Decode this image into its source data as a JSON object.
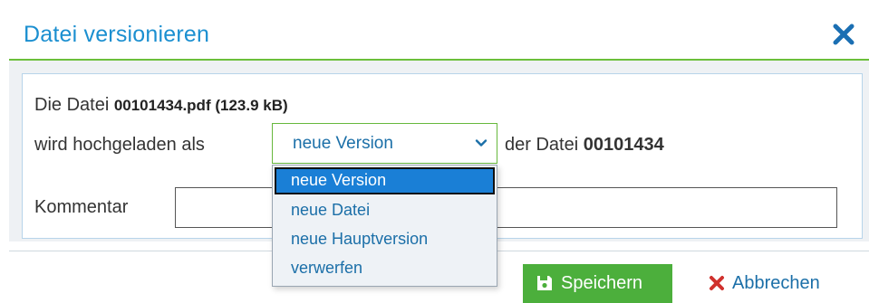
{
  "dialog": {
    "title": "Datei versionieren",
    "close_icon": "close-icon",
    "accent_color": "#1b8fd0",
    "rule_color": "#6bbf3a"
  },
  "body": {
    "line1_prefix": "Die Datei ",
    "file_info": "00101434.pdf (123.9 kB)",
    "line2_prefix": "wird hochgeladen als",
    "line2_suffix": "der Datei ",
    "target_file": "00101434",
    "select": {
      "selected_value": "neue Version",
      "chevron_icon": "chevron-down-icon",
      "options": [
        "neue Version",
        "neue Datei",
        "neue Hauptversion",
        "verwerfen"
      ]
    },
    "comment_label": "Kommentar",
    "comment_value": ""
  },
  "footer": {
    "save_label": "Speichern",
    "save_icon": "floppy-disk-icon",
    "save_color": "#4caf3c",
    "cancel_label": "Abbrechen",
    "cancel_icon": "x-icon",
    "cancel_icon_color": "#d0312d"
  }
}
